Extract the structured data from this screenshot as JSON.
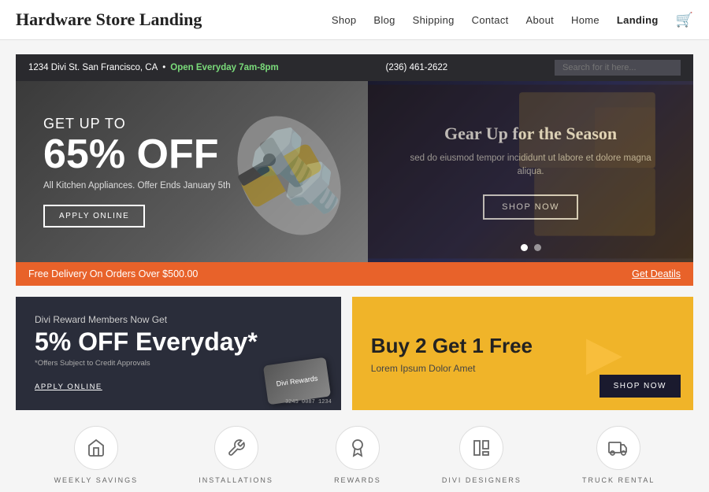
{
  "header": {
    "logo": "Hardware Store Landing",
    "nav": [
      {
        "label": "Shop",
        "active": false
      },
      {
        "label": "Blog",
        "active": false
      },
      {
        "label": "Shipping",
        "active": false
      },
      {
        "label": "Contact",
        "active": false
      },
      {
        "label": "About",
        "active": false
      },
      {
        "label": "Home",
        "active": false
      },
      {
        "label": "Landing",
        "active": true
      }
    ]
  },
  "infobar": {
    "address": "1234 Divi St. San Francisco, CA",
    "open": "Open Everyday 7am-8pm",
    "phone": "(236) 461-2622",
    "search_placeholder": "Search for it here..."
  },
  "hero_left": {
    "get_up_to": "GET UP TO",
    "discount": "65% OFF",
    "subtitle": "All Kitchen Appliances. Offer Ends January 5th",
    "btn": "APPLY ONLINE"
  },
  "hero_right": {
    "title": "Gear Up for the Season",
    "text": "sed do eiusmod tempor incididunt ut labore et dolore magna aliqua.",
    "btn": "SHOP NOW"
  },
  "promo_bar": {
    "text": "Free Delivery On Orders Over $500.00",
    "link": "Get Deatils"
  },
  "card_rewards": {
    "title": "Divi Reward Members Now Get",
    "percent": "5% OFF Everyday*",
    "note": "*Offers Subject to Credit Approvals",
    "btn": "APPLY ONLINE",
    "card_label": "Divi Rewards",
    "card_number": "3245 0087 1234"
  },
  "card_buy2": {
    "title": "Buy 2 Get 1 Free",
    "subtitle": "Lorem Ipsum Dolor Amet",
    "btn": "SHOP NOW"
  },
  "icons": [
    {
      "icon": "🏷",
      "label": "WEEKLY SAVINGS"
    },
    {
      "icon": "🔧",
      "label": "INSTALLATIONS"
    },
    {
      "icon": "🏆",
      "label": "REWARDS"
    },
    {
      "icon": "📊",
      "label": "DIVI DESIGNERS"
    },
    {
      "icon": "🚚",
      "label": "TRUCK RENTAL"
    }
  ]
}
